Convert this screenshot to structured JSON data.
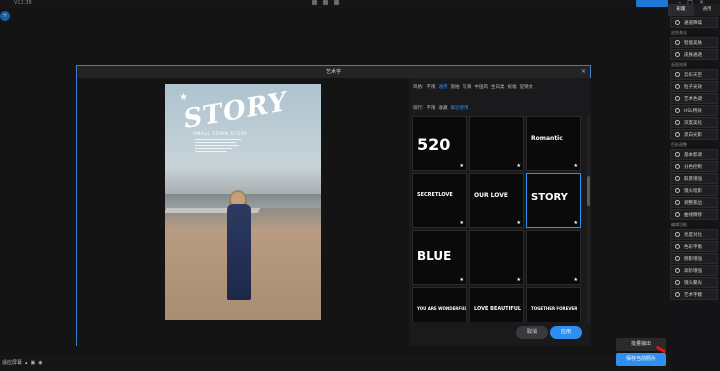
{
  "app": {
    "version": "V11.38",
    "upgrade_badge": ""
  },
  "right_panel": {
    "tabs": [
      "彩版",
      "通用"
    ],
    "groups": [
      {
        "section": "",
        "items": [
          "通道降噪"
        ]
      },
      {
        "section": "皮肤美化",
        "items": [
          "智能美肤",
          "皮肤通透"
        ]
      },
      {
        "section": "画面效果",
        "items": [
          "云彩天空",
          "粒子光效",
          "艺术色调",
          "HSL特效",
          "深度美化",
          "黑白光影"
        ]
      },
      {
        "section": "色彩调整",
        "items": [
          "基本影调",
          "分色控制",
          "取景增强",
          "镜头暗影",
          "调整紫边",
          "曲线精修"
        ]
      },
      {
        "section": "编辑功能",
        "items": [
          "亮度对比",
          "色彩平衡",
          "阴影增强",
          "高阶增强",
          "镜头聚光",
          "艺术字模"
        ]
      }
    ]
  },
  "dialog": {
    "title": "艺术字",
    "close": "×",
    "filters_label": "风格:",
    "filters": [
      "不限",
      "通用",
      "旅拍",
      "写真",
      "中国风",
      "生日类",
      "祝福",
      "促销文"
    ],
    "filters_selected": 1,
    "sort_label": "排行:",
    "sort": [
      "不限",
      "收藏",
      "最近使用"
    ],
    "sort_selected": 2,
    "photo_overlay": {
      "title": "STORY",
      "subtitle": "SMALL TOWN STORY"
    },
    "templates": [
      {
        "text": "520",
        "size": "16px"
      },
      {
        "text": "",
        "size": "6px"
      },
      {
        "text": "Romantic",
        "size": "6px"
      },
      {
        "text": "SECRETLOVE",
        "size": "5px"
      },
      {
        "text": "OUR LOVE",
        "size": "6px"
      },
      {
        "text": "STORY",
        "size": "10px"
      },
      {
        "text": "BLUE",
        "size": "12px"
      },
      {
        "text": "",
        "size": "6px"
      },
      {
        "text": "",
        "size": "6px"
      },
      {
        "text": "YOU ARE WONDERFUL",
        "size": "4px"
      },
      {
        "text": "LOVE BEAUTIFUL",
        "size": "5px"
      },
      {
        "text": "TOGETHER FOREVER",
        "size": "4px"
      }
    ],
    "selected_template": 5,
    "cancel": "取消",
    "ok": "应用"
  },
  "bottom": {
    "fit_screen": "适应屏幕",
    "batch_export": "批量输出",
    "save_current": "保存当前照片"
  }
}
